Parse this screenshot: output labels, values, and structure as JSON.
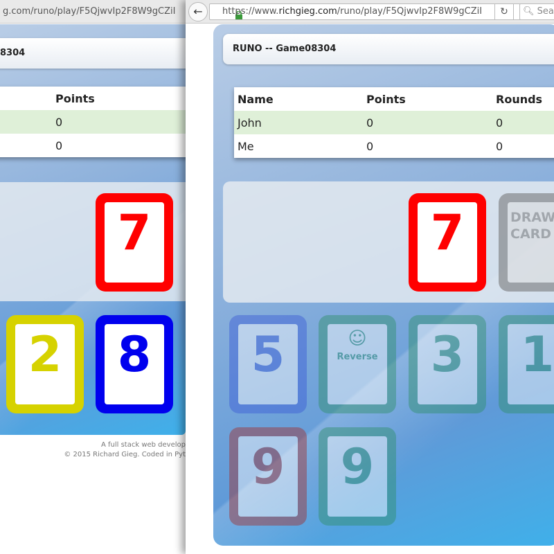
{
  "left_window": {
    "url_path": "g.com/runo/play/F5QjwvIp2F8W9gCZiI",
    "title_fragment": "8304",
    "table": {
      "header": "Points",
      "rows": [
        "0",
        "0"
      ]
    },
    "discard_card": {
      "value": "7",
      "color": "red"
    },
    "hand": [
      {
        "value": "2",
        "color": "yellow"
      },
      {
        "value": "8",
        "color": "blue"
      }
    ],
    "footer": {
      "line1": "A full stack web develop",
      "line2": "© 2015 Richard Gieg. Coded in Pyt"
    }
  },
  "right_window": {
    "toolbar": {
      "back_icon": "back-arrow-icon",
      "url_scheme": "https://www.",
      "url_host": "richgieg.com",
      "url_path": "/runo/play/F5QjwvIp2F8W9gCZiI",
      "reload_icon": "↻",
      "search_placeholder": "Search"
    },
    "game_title": "RUNO -- Game08304",
    "table": {
      "headers": [
        "Name",
        "Points",
        "Rounds"
      ],
      "rows": [
        [
          "John",
          "0",
          "0"
        ],
        [
          "Me",
          "0",
          "0"
        ]
      ]
    },
    "discard_card": {
      "value": "7",
      "color": "red"
    },
    "draw_card": {
      "line1": "DRAW",
      "line2": "CARD"
    },
    "hand": [
      {
        "value": "5",
        "color": "blue"
      },
      {
        "value": "Reverse",
        "icon": "☺",
        "color": "green"
      },
      {
        "value": "3",
        "color": "green"
      },
      {
        "value": "1",
        "color": "green"
      },
      {
        "value": "9",
        "color": "red"
      },
      {
        "value": "9",
        "color": "green"
      }
    ]
  },
  "colors": {
    "red": "#ff0000",
    "yellow": "#d6d200",
    "blue": "#0000ee",
    "row_highlight": "#dff0d8"
  }
}
